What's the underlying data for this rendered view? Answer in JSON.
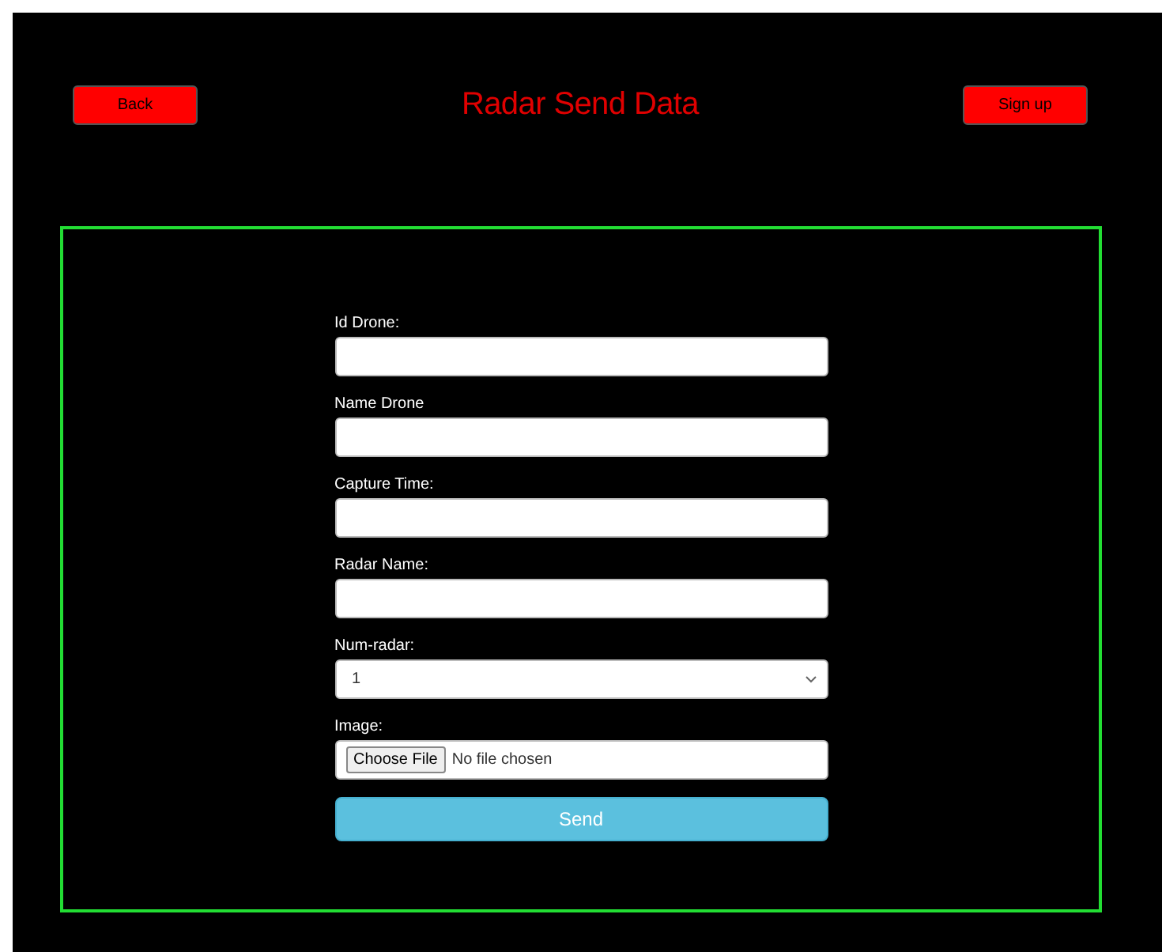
{
  "header": {
    "back_button": "Back",
    "title": "Radar Send Data",
    "signup_button": "Sign up"
  },
  "form": {
    "fields": [
      {
        "kind": "text",
        "label": "Id Drone:"
      },
      {
        "kind": "text",
        "label": "Name Drone"
      },
      {
        "kind": "text",
        "label": "Capture Time:"
      },
      {
        "kind": "text",
        "label": "Radar Name:"
      },
      {
        "kind": "select",
        "label": "Num-radar:",
        "value": "1"
      },
      {
        "kind": "file",
        "label": "Image:",
        "button": "Choose File",
        "status": "No file chosen"
      }
    ],
    "submit": "Send"
  }
}
